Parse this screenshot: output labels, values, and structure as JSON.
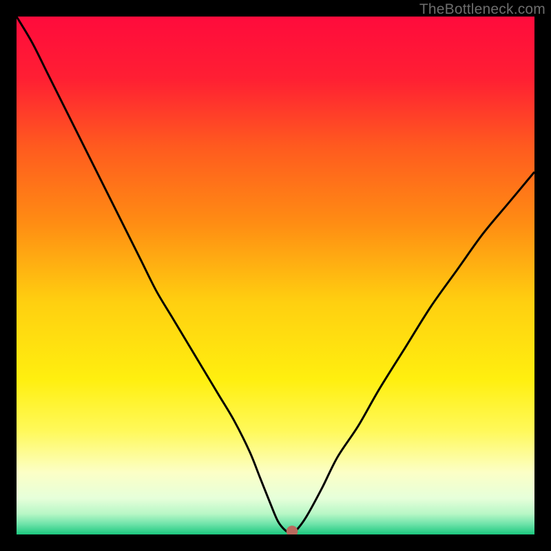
{
  "watermark": {
    "text": "TheBottleneck.com"
  },
  "colors": {
    "frame": "#000000",
    "curve": "#000000",
    "marker": "#b96a5e"
  },
  "chart_data": {
    "type": "line",
    "title": "",
    "xlabel": "",
    "ylabel": "",
    "xlim": [
      0,
      100
    ],
    "ylim": [
      0,
      100
    ],
    "grid": false,
    "legend": "none",
    "background_gradient_stops": [
      {
        "pos": 0,
        "color": "#ff0b3c"
      },
      {
        "pos": 12,
        "color": "#ff1f33"
      },
      {
        "pos": 25,
        "color": "#ff5a1f"
      },
      {
        "pos": 40,
        "color": "#ff8d13"
      },
      {
        "pos": 55,
        "color": "#ffcf10"
      },
      {
        "pos": 70,
        "color": "#ffef0f"
      },
      {
        "pos": 80,
        "color": "#fff95a"
      },
      {
        "pos": 88,
        "color": "#fcffc6"
      },
      {
        "pos": 93,
        "color": "#e6ffda"
      },
      {
        "pos": 96,
        "color": "#b8f7c6"
      },
      {
        "pos": 98,
        "color": "#6ee3a9"
      },
      {
        "pos": 100,
        "color": "#1cc87f"
      }
    ],
    "series": [
      {
        "name": "bottleneck-curve",
        "x": [
          0,
          3,
          6,
          9,
          12,
          15,
          18,
          21,
          24,
          27,
          30,
          33,
          36,
          39,
          42,
          45,
          47,
          49,
          50.5,
          52,
          53,
          54,
          56,
          59,
          62,
          66,
          70,
          75,
          80,
          85,
          90,
          95,
          100
        ],
        "y": [
          100,
          95,
          89,
          83,
          77,
          71,
          65,
          59,
          53,
          47,
          42,
          37,
          32,
          27,
          22,
          16,
          11,
          6,
          2.5,
          0.7,
          0.4,
          0.8,
          3.5,
          9,
          15,
          21,
          28,
          36,
          44,
          51,
          58,
          64,
          70
        ]
      }
    ],
    "marker": {
      "x": 53.2,
      "y": 0.6,
      "r": 1.1
    }
  }
}
